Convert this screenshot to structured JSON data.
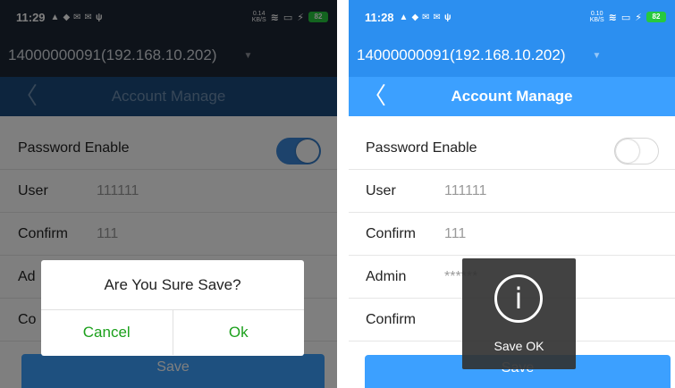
{
  "left": {
    "status": {
      "time": "11:29",
      "net_speed_value": "0.14",
      "net_speed_unit": "KB/S",
      "battery": "82"
    },
    "device": {
      "name": "14000000091(192.168.10.202)"
    },
    "nav": {
      "title": "Account Manage"
    },
    "form": {
      "password_enable_label": "Password Enable",
      "password_enable_on": true,
      "rows": [
        {
          "label": "User",
          "value": "111111"
        },
        {
          "label": "Confirm",
          "value": "111"
        },
        {
          "label": "Ad",
          "value": ""
        },
        {
          "label": "Co",
          "value": ""
        }
      ]
    },
    "save_label": "Save",
    "dialog": {
      "message": "Are You Sure Save?",
      "cancel_label": "Cancel",
      "ok_label": "Ok"
    }
  },
  "right": {
    "status": {
      "time": "11:28",
      "net_speed_value": "0.10",
      "net_speed_unit": "KB/S",
      "battery": "82"
    },
    "device": {
      "name": "14000000091(192.168.10.202)"
    },
    "nav": {
      "title": "Account Manage"
    },
    "form": {
      "password_enable_label": "Password Enable",
      "password_enable_on": false,
      "rows": [
        {
          "label": "User",
          "value": "111111"
        },
        {
          "label": "Confirm",
          "value": "111"
        },
        {
          "label": "Admin",
          "value": "******"
        },
        {
          "label": "Confirm",
          "value": ""
        }
      ]
    },
    "save_label": "Save",
    "toast": {
      "text": "Save OK",
      "icon": "info-icon"
    }
  },
  "colors": {
    "accent": "#3ca0ff",
    "ok_green": "#1ca01c",
    "toggle_on": "#3a87d9"
  }
}
